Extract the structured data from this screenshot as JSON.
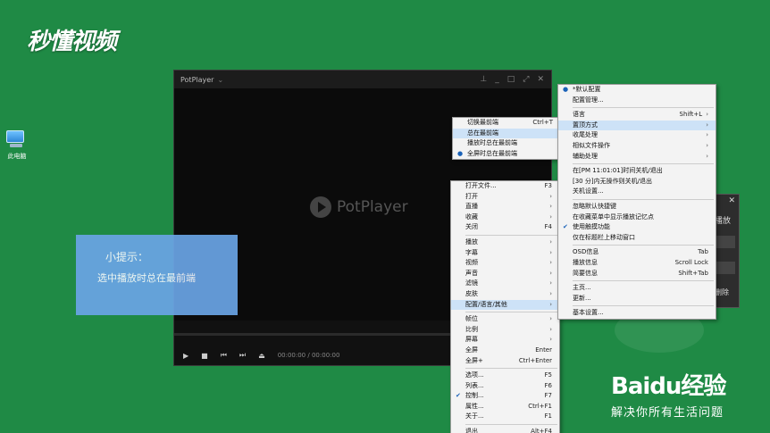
{
  "watermark": "秒懂视频",
  "desktop_icon_label": "此电脑",
  "player": {
    "title": "PotPlayer",
    "logo_text": "PotPlayer",
    "time_current": "00:00:00",
    "time_total": "00:00:00"
  },
  "tip": {
    "heading": "小提示：",
    "body": "选中播放时总在最前端"
  },
  "ontop_menu": [
    {
      "label": "切换最前端",
      "shortcut": "Ctrl+T"
    },
    {
      "label": "总在最前端",
      "shortcut": "",
      "highlight": true
    },
    {
      "label": "播放时总在最前端",
      "shortcut": ""
    },
    {
      "label": "全屏时总在最前端",
      "shortcut": "",
      "bullet": true
    }
  ],
  "main_menu": [
    {
      "label": "打开文件...",
      "shortcut": "F3"
    },
    {
      "label": "打开",
      "arrow": true
    },
    {
      "label": "直播",
      "arrow": true
    },
    {
      "label": "收藏",
      "arrow": true
    },
    {
      "label": "关闭",
      "shortcut": "F4"
    },
    {
      "sep": true
    },
    {
      "label": "播放",
      "arrow": true
    },
    {
      "label": "字幕",
      "arrow": true
    },
    {
      "label": "视频",
      "arrow": true
    },
    {
      "label": "声音",
      "arrow": true
    },
    {
      "label": "滤镜",
      "arrow": true
    },
    {
      "label": "皮肤",
      "arrow": true
    },
    {
      "label": "配置/语言/其他",
      "arrow": true,
      "highlight": true
    },
    {
      "sep": true
    },
    {
      "label": "帧位",
      "arrow": true
    },
    {
      "label": "比例",
      "arrow": true
    },
    {
      "label": "屏幕",
      "arrow": true
    },
    {
      "label": "全屏",
      "shortcut": "Enter"
    },
    {
      "label": "全屏+",
      "shortcut": "Ctrl+Enter"
    },
    {
      "sep": true
    },
    {
      "label": "选项...",
      "shortcut": "F5"
    },
    {
      "label": "列表...",
      "shortcut": "F6"
    },
    {
      "label": "控制...",
      "shortcut": "F7",
      "check": true
    },
    {
      "label": "属性...",
      "shortcut": "Ctrl+F1"
    },
    {
      "label": "关于...",
      "shortcut": "F1"
    },
    {
      "sep": true
    },
    {
      "label": "退出",
      "shortcut": "Alt+F4"
    }
  ],
  "config_menu": [
    {
      "label": "*默认配置",
      "bullet": true
    },
    {
      "label": "配置管理..."
    },
    {
      "sep": true
    },
    {
      "label": "语言",
      "shortcut": "Shift+L",
      "arrow": true
    },
    {
      "label": "置顶方式",
      "arrow": true,
      "highlight": true
    },
    {
      "label": "收尾处理",
      "arrow": true
    },
    {
      "label": "相似文件操作",
      "arrow": true
    },
    {
      "label": "辅助处理",
      "arrow": true
    },
    {
      "sep": true
    },
    {
      "label": "在[PM 11:01:01]时间关机/退出"
    },
    {
      "label": "[30 分]内无操作则关机/退出"
    },
    {
      "label": "关机设置..."
    },
    {
      "sep": true
    },
    {
      "label": "忽略默认快捷键"
    },
    {
      "label": "在收藏菜单中显示播放记忆点"
    },
    {
      "label": "使用触摸功能",
      "check": true
    },
    {
      "label": "仅在标题栏上移动窗口"
    },
    {
      "sep": true
    },
    {
      "label": "OSD信息",
      "shortcut": "Tab"
    },
    {
      "label": "播放信息",
      "shortcut": "Scroll Lock"
    },
    {
      "label": "简要信息",
      "shortcut": "Shift+Tab"
    },
    {
      "sep": true
    },
    {
      "label": "主页..."
    },
    {
      "label": "更新..."
    },
    {
      "sep": true
    },
    {
      "label": "基本设置..."
    }
  ],
  "side_panel": {
    "title": "播放",
    "button": "删除"
  },
  "baidu": {
    "logo": "Baidu经验",
    "slogan": "解决你所有生活问题"
  }
}
